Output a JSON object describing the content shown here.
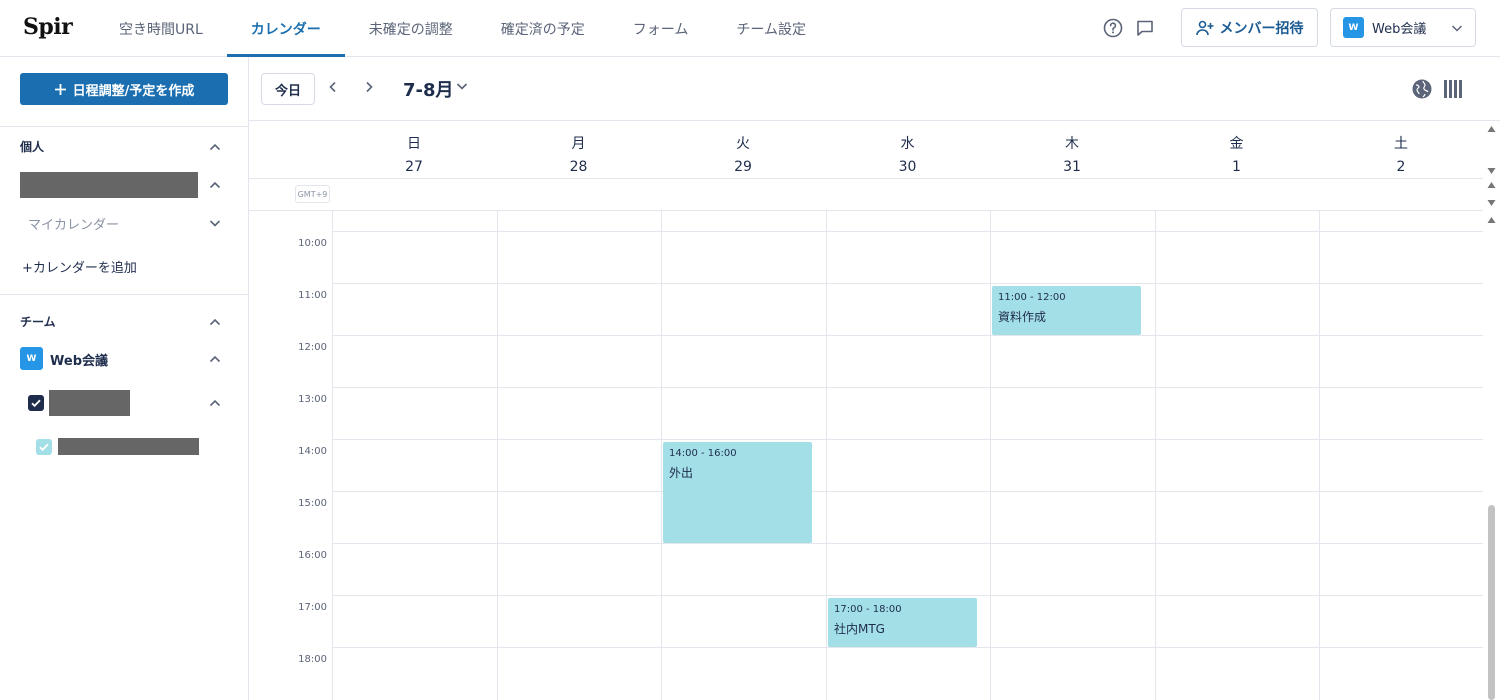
{
  "app": {
    "logo": "Spir"
  },
  "nav": {
    "tabs": [
      {
        "label": "空き時間URL",
        "active": false
      },
      {
        "label": "カレンダー",
        "active": true
      },
      {
        "label": "未確定の調整",
        "active": false
      },
      {
        "label": "確定済の予定",
        "active": false
      },
      {
        "label": "フォーム",
        "active": false
      },
      {
        "label": "チーム設定",
        "active": false
      }
    ],
    "invite_label": "メンバー招待",
    "team_badge": "W",
    "team_name": "Web会議"
  },
  "sidebar": {
    "create_label": "日程調整/予定を作成",
    "personal_label": "個人",
    "my_calendar_label": "マイカレンダー",
    "add_calendar_label": "+カレンダーを追加",
    "team_label": "チーム",
    "team_badge": "W",
    "team_name": "Web会議"
  },
  "toolbar": {
    "today_label": "今日",
    "month_label": "7-8月"
  },
  "calendar": {
    "timezone": "GMT+9",
    "days": [
      {
        "dow": "日",
        "date": "27"
      },
      {
        "dow": "月",
        "date": "28"
      },
      {
        "dow": "火",
        "date": "29"
      },
      {
        "dow": "水",
        "date": "30"
      },
      {
        "dow": "木",
        "date": "31"
      },
      {
        "dow": "金",
        "date": "1"
      },
      {
        "dow": "土",
        "date": "2"
      }
    ],
    "hours": [
      "10:00",
      "11:00",
      "12:00",
      "13:00",
      "14:00",
      "15:00",
      "16:00",
      "17:00",
      "18:00"
    ],
    "events": [
      {
        "day_index": 4,
        "start": 11,
        "end": 12,
        "time": "11:00 - 12:00",
        "title": "資料作成"
      },
      {
        "day_index": 2,
        "start": 14,
        "end": 16,
        "time": "14:00 - 16:00",
        "title": "外出"
      },
      {
        "day_index": 3,
        "start": 17,
        "end": 18,
        "time": "17:00 - 18:00",
        "title": "社内MTG"
      }
    ],
    "event_color": "#a3dfe6"
  },
  "colors": {
    "accent": "#1b6fb0",
    "team_badge": "#2596e6"
  }
}
